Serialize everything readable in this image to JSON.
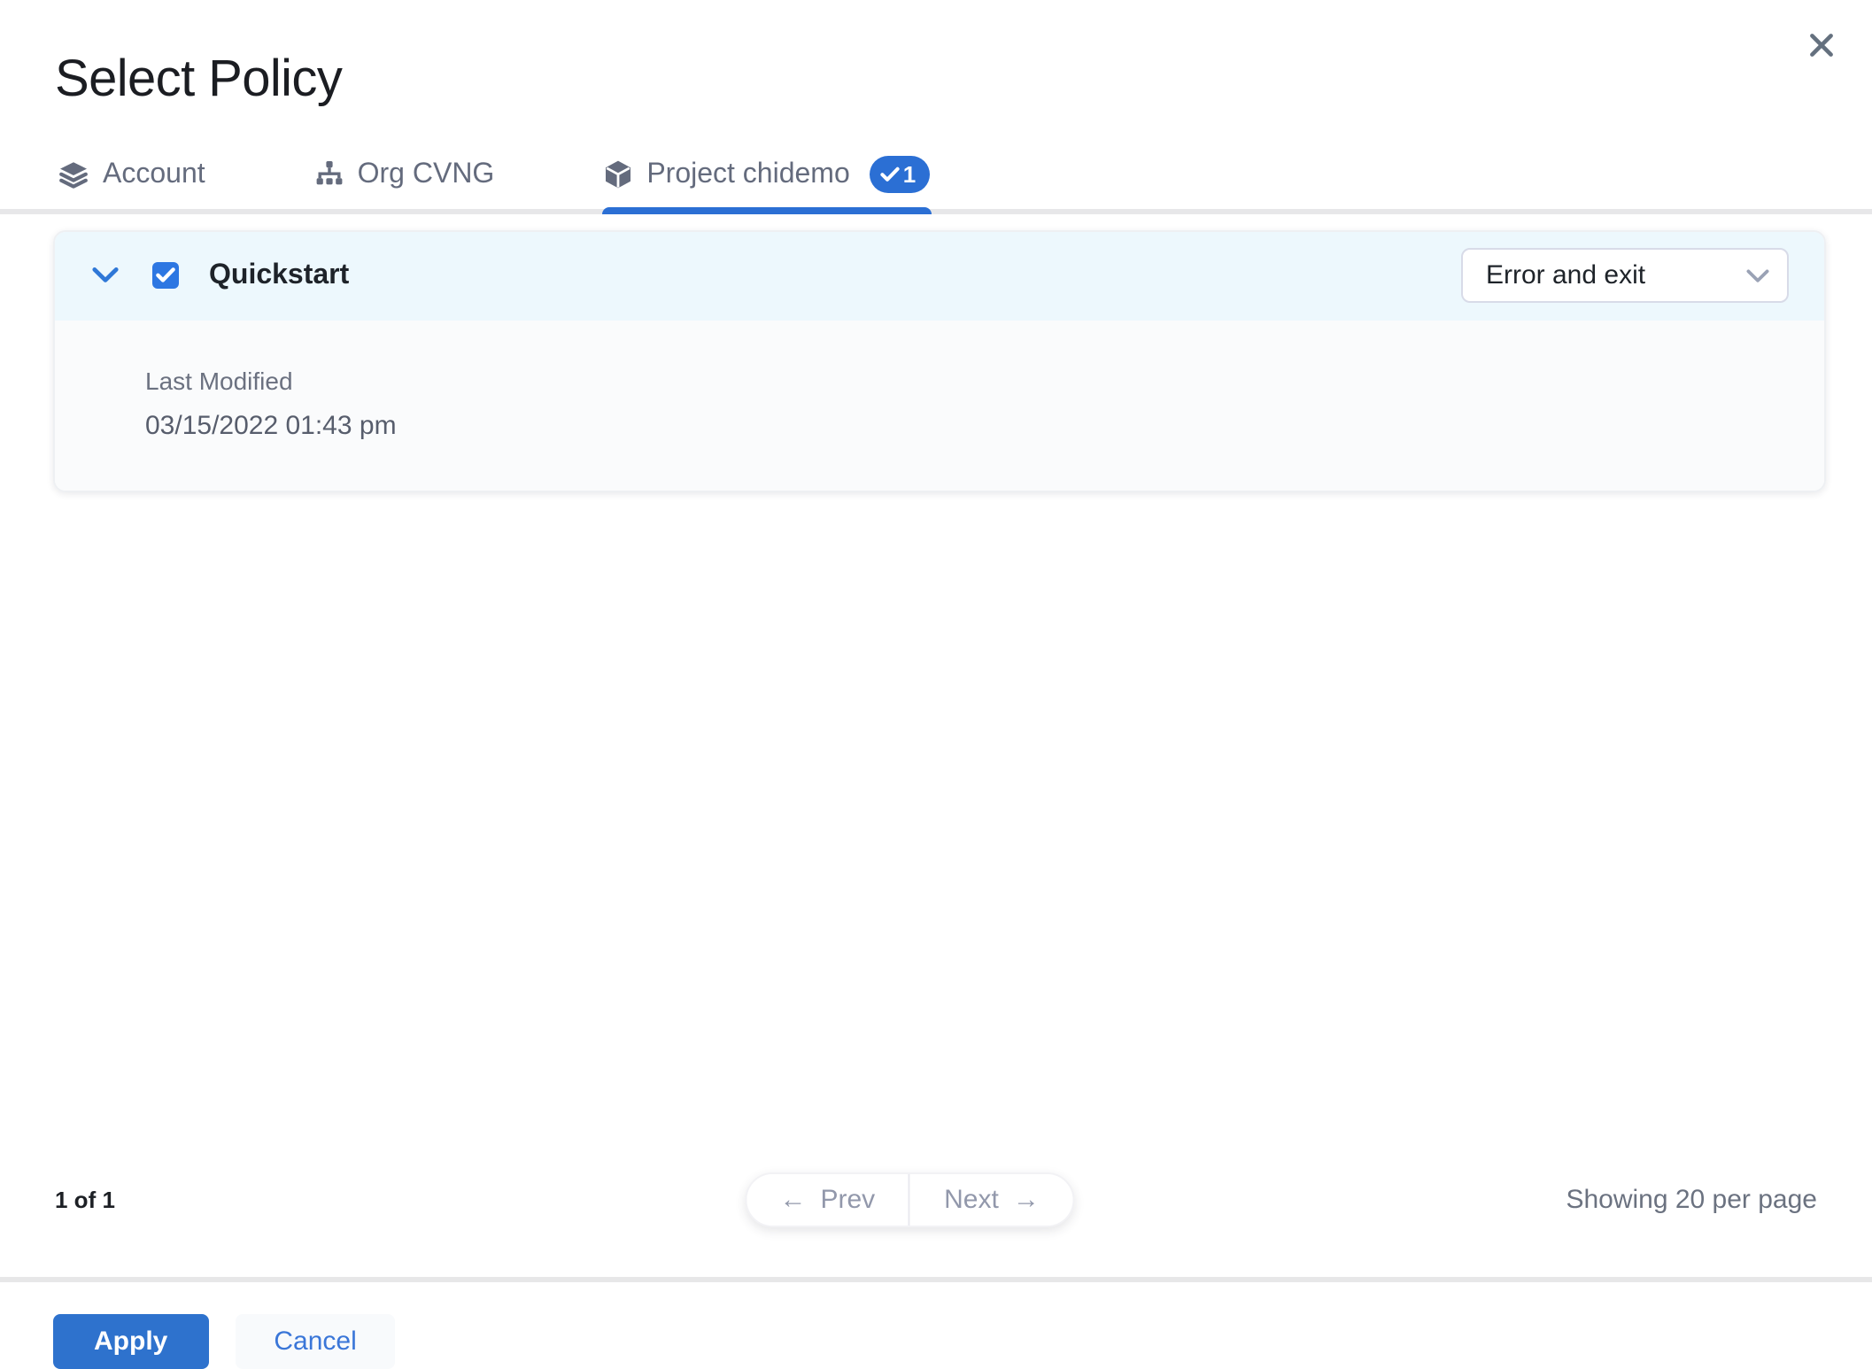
{
  "modal": {
    "title": "Select Policy"
  },
  "tabs": [
    {
      "label": "Account",
      "icon": "layers-icon",
      "active": false
    },
    {
      "label": "Org CVNG",
      "icon": "org-tree-icon",
      "active": false
    },
    {
      "label": "Project chidemo",
      "icon": "cube-icon",
      "active": true,
      "badge": {
        "icon": "check-icon",
        "count": "1"
      }
    }
  ],
  "policies": [
    {
      "name": "Quickstart",
      "checked": true,
      "expanded": true,
      "action": {
        "selected": "Error and exit"
      },
      "details": {
        "last_modified_label": "Last Modified",
        "last_modified_value": "03/15/2022 01:43 pm"
      }
    }
  ],
  "pagination": {
    "page_info": "1 of 1",
    "prev_arrow": "←",
    "prev_label": "Prev",
    "next_label": "Next",
    "next_arrow": "→",
    "per_page": "Showing 20 per page"
  },
  "footer": {
    "apply_label": "Apply",
    "cancel_label": "Cancel"
  },
  "colors": {
    "primary_blue": "#2b6fd4",
    "checkbox_blue": "#2d77e2",
    "header_bg": "#edf8fd",
    "card_body_bg": "#fafbfc",
    "slate_text": "#646b7d",
    "muted_text": "#6b7280",
    "disabled_text": "#9298ab",
    "divider_gray": "#e7e7e9"
  }
}
